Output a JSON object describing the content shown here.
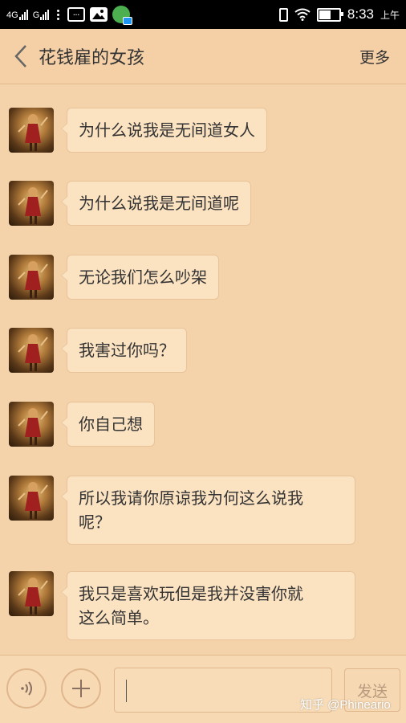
{
  "status_bar": {
    "network1": "4G",
    "network2": "G",
    "time": "8:33",
    "ampm": "上午"
  },
  "header": {
    "back_icon": "chevron-left-icon",
    "title": "花钱雇的女孩",
    "more_label": "更多"
  },
  "messages": [
    {
      "lines": [
        "为什么说我是无间道女人"
      ]
    },
    {
      "lines": [
        "为什么说我是无间道呢"
      ]
    },
    {
      "lines": [
        "无论我们怎么吵架"
      ]
    },
    {
      "lines": [
        "我害过你吗？"
      ]
    },
    {
      "lines": [
        "你自己想"
      ]
    },
    {
      "lines": [
        "所以我请你原谅我为何这么说我",
        "呢？"
      ]
    },
    {
      "lines": [
        "我只是喜欢玩但是我并没害你就",
        "这么简单。"
      ]
    }
  ],
  "input_bar": {
    "voice_icon": "voice-icon",
    "plus_icon": "plus-icon",
    "input_value": "",
    "send_label": "发送"
  },
  "watermark": "知乎 @Phineario",
  "colors": {
    "background": "#f4d3aa",
    "bubble": "#fbe2c1",
    "bubble_border": "#e8c39a"
  }
}
